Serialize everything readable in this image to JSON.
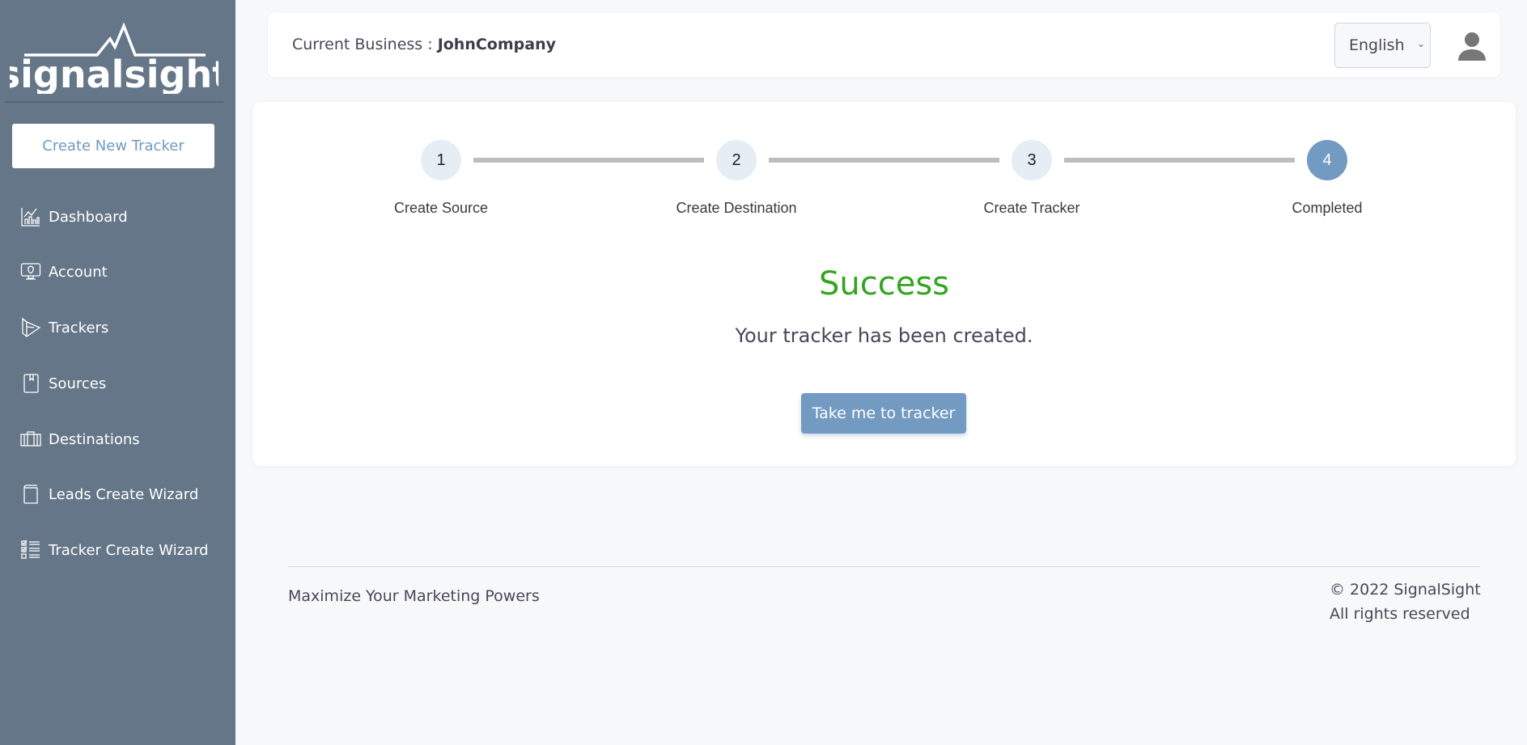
{
  "brand": {
    "logo_text": "signalsight",
    "accent": "#739ac0",
    "sidebar_bg": "#657688",
    "success_color": "#33a51f"
  },
  "sidebar": {
    "create_button": "Create New Tracker",
    "items": [
      {
        "label": "Dashboard",
        "icon": "chart-icon"
      },
      {
        "label": "Account",
        "icon": "monitor-shield-icon"
      },
      {
        "label": "Trackers",
        "icon": "play-icon"
      },
      {
        "label": "Sources",
        "icon": "bookmark-book-icon"
      },
      {
        "label": "Destinations",
        "icon": "briefcase-icon"
      },
      {
        "label": "Leads Create Wizard",
        "icon": "book-icon"
      },
      {
        "label": "Tracker Create Wizard",
        "icon": "checklist-icon"
      }
    ]
  },
  "header": {
    "business_label": "Current Business :",
    "business_name": "JohnCompany",
    "language": "English"
  },
  "wizard": {
    "steps": [
      {
        "number": "1",
        "label": "Create Source"
      },
      {
        "number": "2",
        "label": "Create Destination"
      },
      {
        "number": "3",
        "label": "Create Tracker"
      },
      {
        "number": "4",
        "label": "Completed"
      }
    ],
    "active_step": 4,
    "title": "Success",
    "message": "Your tracker has been created.",
    "button": "Take me to tracker"
  },
  "footer": {
    "tagline": "Maximize Your Marketing Powers",
    "copyright": "© 2022 SignalSight",
    "rights": "All rights reserved"
  }
}
